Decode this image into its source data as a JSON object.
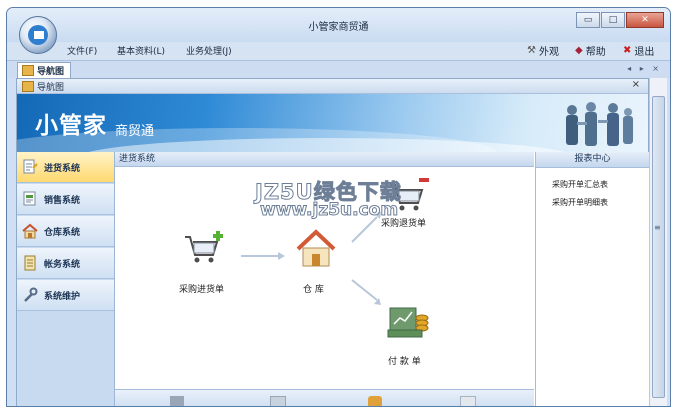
{
  "window": {
    "title": "小管家商贸通",
    "buttons": {
      "minimize": "▭",
      "maximize": "□",
      "close": "✕"
    }
  },
  "menubar": {
    "items": [
      "文件(F)",
      "基本资料(L)",
      "业务处理(J)"
    ],
    "right": [
      {
        "label": "外观",
        "icon": "tools-icon"
      },
      {
        "label": "帮助",
        "icon": "help-icon"
      },
      {
        "label": "退出",
        "icon": "exit-icon"
      }
    ]
  },
  "tabs": {
    "active": "导航图",
    "controls": "◂ ▸ ×"
  },
  "panel": {
    "title": "导航图",
    "close": "×"
  },
  "banner": {
    "title": "小管家",
    "subtitle": "商贸通"
  },
  "sidebar": {
    "items": [
      {
        "label": "进货系统",
        "icon": "purchase-doc-icon",
        "active": true
      },
      {
        "label": "销售系统",
        "icon": "sales-doc-icon",
        "active": false
      },
      {
        "label": "仓库系统",
        "icon": "warehouse-icon",
        "active": false
      },
      {
        "label": "帐务系统",
        "icon": "ledger-icon",
        "active": false
      },
      {
        "label": "系统维护",
        "icon": "wrench-icon",
        "active": false
      }
    ]
  },
  "main": {
    "heading": "进货系统",
    "watermark_line1": "JZ5U绿色下载",
    "watermark_line2": "www.jz5u.com",
    "flow": {
      "purchase_order": "采购进货单",
      "warehouse": "仓 库",
      "purchase_return": "采购退货单",
      "payment": "付 款 单"
    }
  },
  "reports": {
    "heading": "报表中心",
    "links": [
      "采购开单汇总表",
      "采购开单明细表"
    ]
  },
  "colors": {
    "accent": "#2f8ad6",
    "active_item": "#ffd970",
    "arrow": "#b7c7d9"
  }
}
